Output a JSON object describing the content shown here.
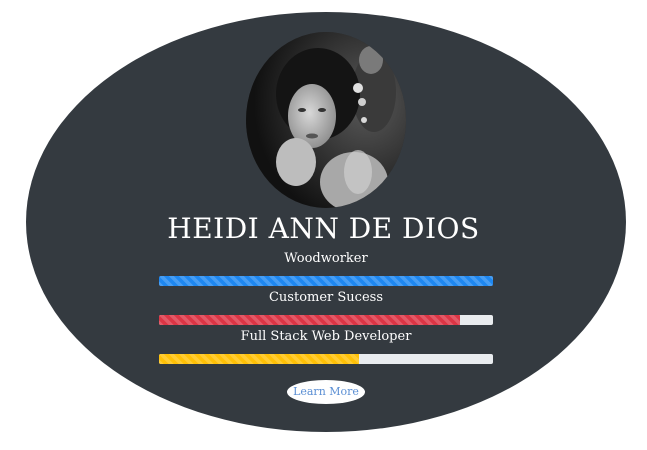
{
  "profile": {
    "name": "HEIDI ANN DE DIOS",
    "avatar_alt": "profile photo"
  },
  "skills": [
    {
      "label": "Woodworker",
      "percent": 100,
      "color": "#1e87f0"
    },
    {
      "label": "Customer Sucess",
      "percent": 90,
      "color": "#dc3545"
    },
    {
      "label": "Full Stack Web Developer",
      "percent": 60,
      "color": "#ffc107"
    }
  ],
  "cta": {
    "label": "Learn More"
  },
  "colors": {
    "card_background": "#343a40",
    "track": "#e9ecef"
  }
}
